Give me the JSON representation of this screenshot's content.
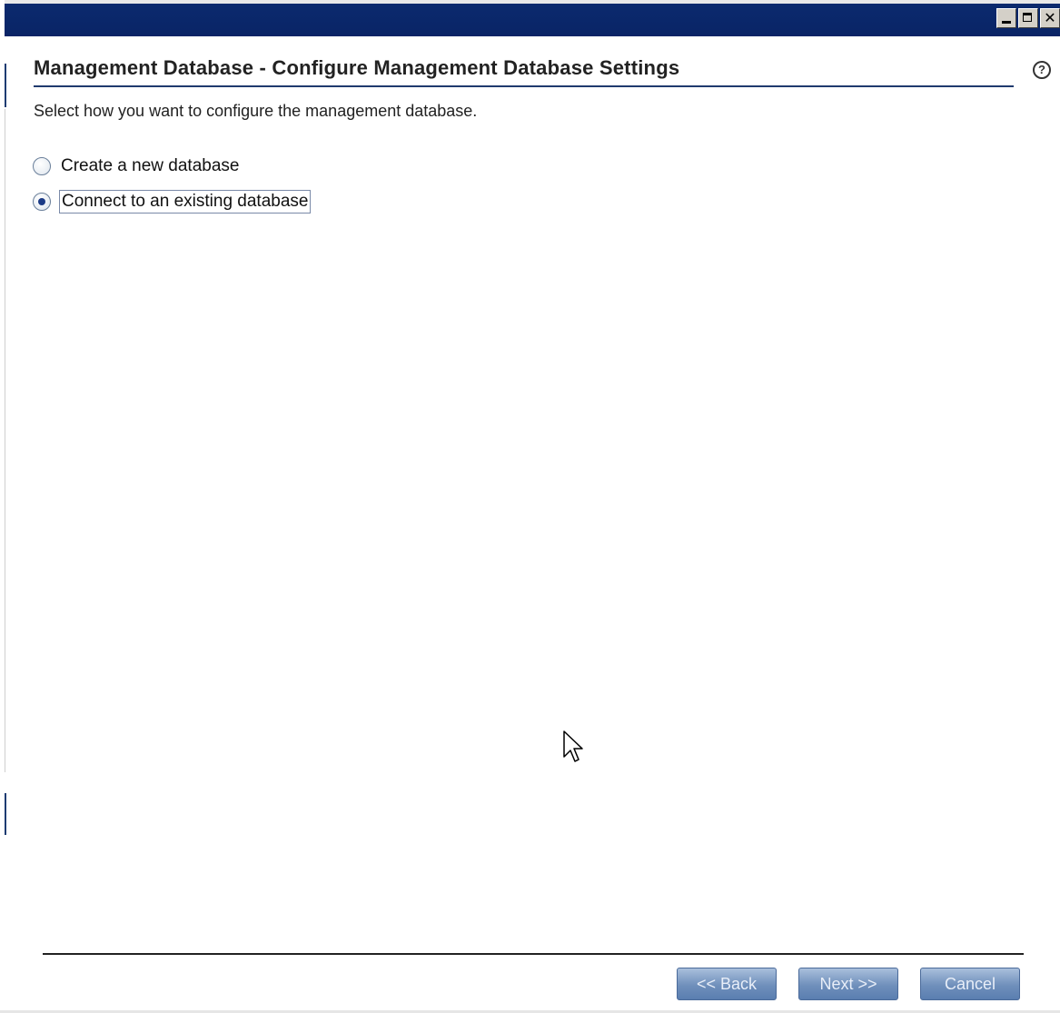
{
  "window": {
    "controls": {
      "minimize_icon": "minimize-icon",
      "maximize_icon": "maximize-icon",
      "close_label": "✕"
    },
    "titlebar_color": "#0b2a6e"
  },
  "page": {
    "title": "Management Database - Configure Management Database Settings",
    "help_label": "?",
    "instructions": "Select how you want to configure the management database."
  },
  "options": [
    {
      "label": "Create a new database",
      "selected": false
    },
    {
      "label": "Connect to an existing database",
      "selected": true
    }
  ],
  "buttons": {
    "back": "<< Back",
    "next": "Next >>",
    "cancel": "Cancel"
  },
  "colors": {
    "accent": "#1f3a6e",
    "button": "#6f8fbb"
  }
}
